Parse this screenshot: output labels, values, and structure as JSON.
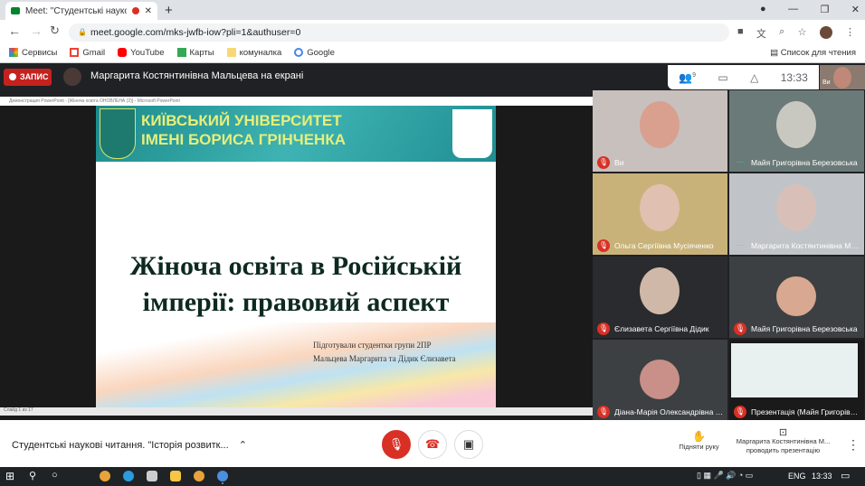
{
  "browser": {
    "tab_title": "Meet: \"Студентські наукові",
    "url": "meet.google.com/mks-jwfb-iow?pli=1&authuser=0",
    "bookmarks": [
      "Сервисы",
      "Gmail",
      "YouTube",
      "Карты",
      "комуналка",
      "Google"
    ],
    "reading_list": "Список для чтения"
  },
  "meet": {
    "record_label": "ЗАПИС",
    "presenting": "Маргарита Костянтинівна Мальцева на екрані",
    "participants_count": "9",
    "time": "13:33",
    "self_label": "Ви",
    "tiles": [
      {
        "name": "Ви",
        "muted": true
      },
      {
        "name": "Майя Григорівна Березовська",
        "muted": false
      },
      {
        "name": "Ольга Сергіївна Мусіяченко",
        "muted": true
      },
      {
        "name": "Маргарита Костянтинівна Мальцева",
        "muted": false
      },
      {
        "name": "Єлизавета Сергіївна Дідик",
        "muted": true
      },
      {
        "name": "Майя Григорівна Березовська",
        "muted": true
      },
      {
        "name": "Діана-Марія Олександрівна Люлька",
        "muted": true
      },
      {
        "name": "Презентація (Майя Григорівна Березовська)",
        "muted": true
      }
    ],
    "meeting_name": "Студентські наукові читання. \"Історія розвитк...",
    "raise_hand": "Підняти руку",
    "presenter_name": "Маргарита Костянтинівна М...",
    "presenter_sub": "проводить презентацію"
  },
  "ppt": {
    "window_title": "Демонстрация PowerPoint - [Жіноча освіта ОНОВЛЕНА (2)] - Microsoft PowerPoint",
    "university_line1": "КИЇВСЬКИЙ УНІВЕРСИТЕТ",
    "university_line2": "ІМЕНІ БОРИСА ГРІНЧЕНКА",
    "title_line1": "Жіноча освіта в Російській",
    "title_line2": "імперії: правовий аспект",
    "sub1": "Підготували студентки групи 2ПР",
    "sub2": "Мальцева Маргарита та Дідик Єлизавета",
    "status": "Слайд 1 из 17"
  },
  "taskbar": {
    "lang": "ENG",
    "time": "13:33"
  }
}
